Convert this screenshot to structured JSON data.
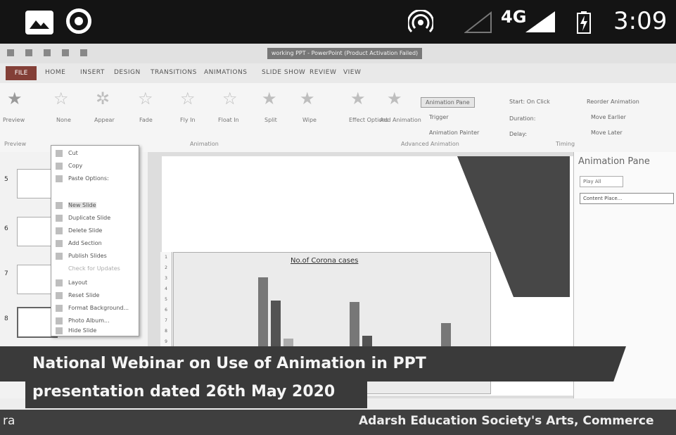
{
  "status_bar": {
    "network": "4G",
    "time": "3:09"
  },
  "window": {
    "title": "working PPT - PowerPoint (Product Activation Failed)"
  },
  "tabs": [
    "FILE",
    "HOME",
    "INSERT",
    "DESIGN",
    "TRANSITIONS",
    "ANIMATIONS",
    "SLIDE SHOW",
    "REVIEW",
    "VIEW"
  ],
  "ribbon": {
    "preview_label": "Preview",
    "animations": [
      "None",
      "Appear",
      "Fade",
      "Fly In",
      "Float In",
      "Split",
      "Wipe"
    ],
    "effect_options": "Effect Options",
    "add_animation": "Add Animation",
    "animation_pane": "Animation Pane",
    "trigger": "Trigger",
    "animation_painter": "Animation Painter",
    "start": "Start: On Click",
    "duration": "Duration:",
    "delay": "Delay:",
    "reorder": "Reorder Animation",
    "move_earlier": "Move Earlier",
    "move_later": "Move Later",
    "groups": [
      "Preview",
      "Animation",
      "Advanced Animation",
      "Timing"
    ]
  },
  "slide_numbers": [
    "5",
    "6",
    "7",
    "8"
  ],
  "context_menu": [
    "Cut",
    "Copy",
    "Paste Options:",
    "New Slide",
    "Duplicate Slide",
    "Delete Slide",
    "Add Section",
    "Publish Slides",
    "Check for Updates",
    "Layout",
    "Reset Slide",
    "Format Background...",
    "Photo Album...",
    "Hide Slide"
  ],
  "chart_title": "No.of Corona cases",
  "animation_pane": {
    "title": "Animation Pane",
    "play_all": "Play All",
    "item": "Content Place..."
  },
  "banner": {
    "line1": "National Webinar on Use of Animation in PPT",
    "line2": "presentation dated 26th May 2020"
  },
  "footer": {
    "left": "ra",
    "right": "Adarsh Education Society's Arts, Commerce"
  }
}
